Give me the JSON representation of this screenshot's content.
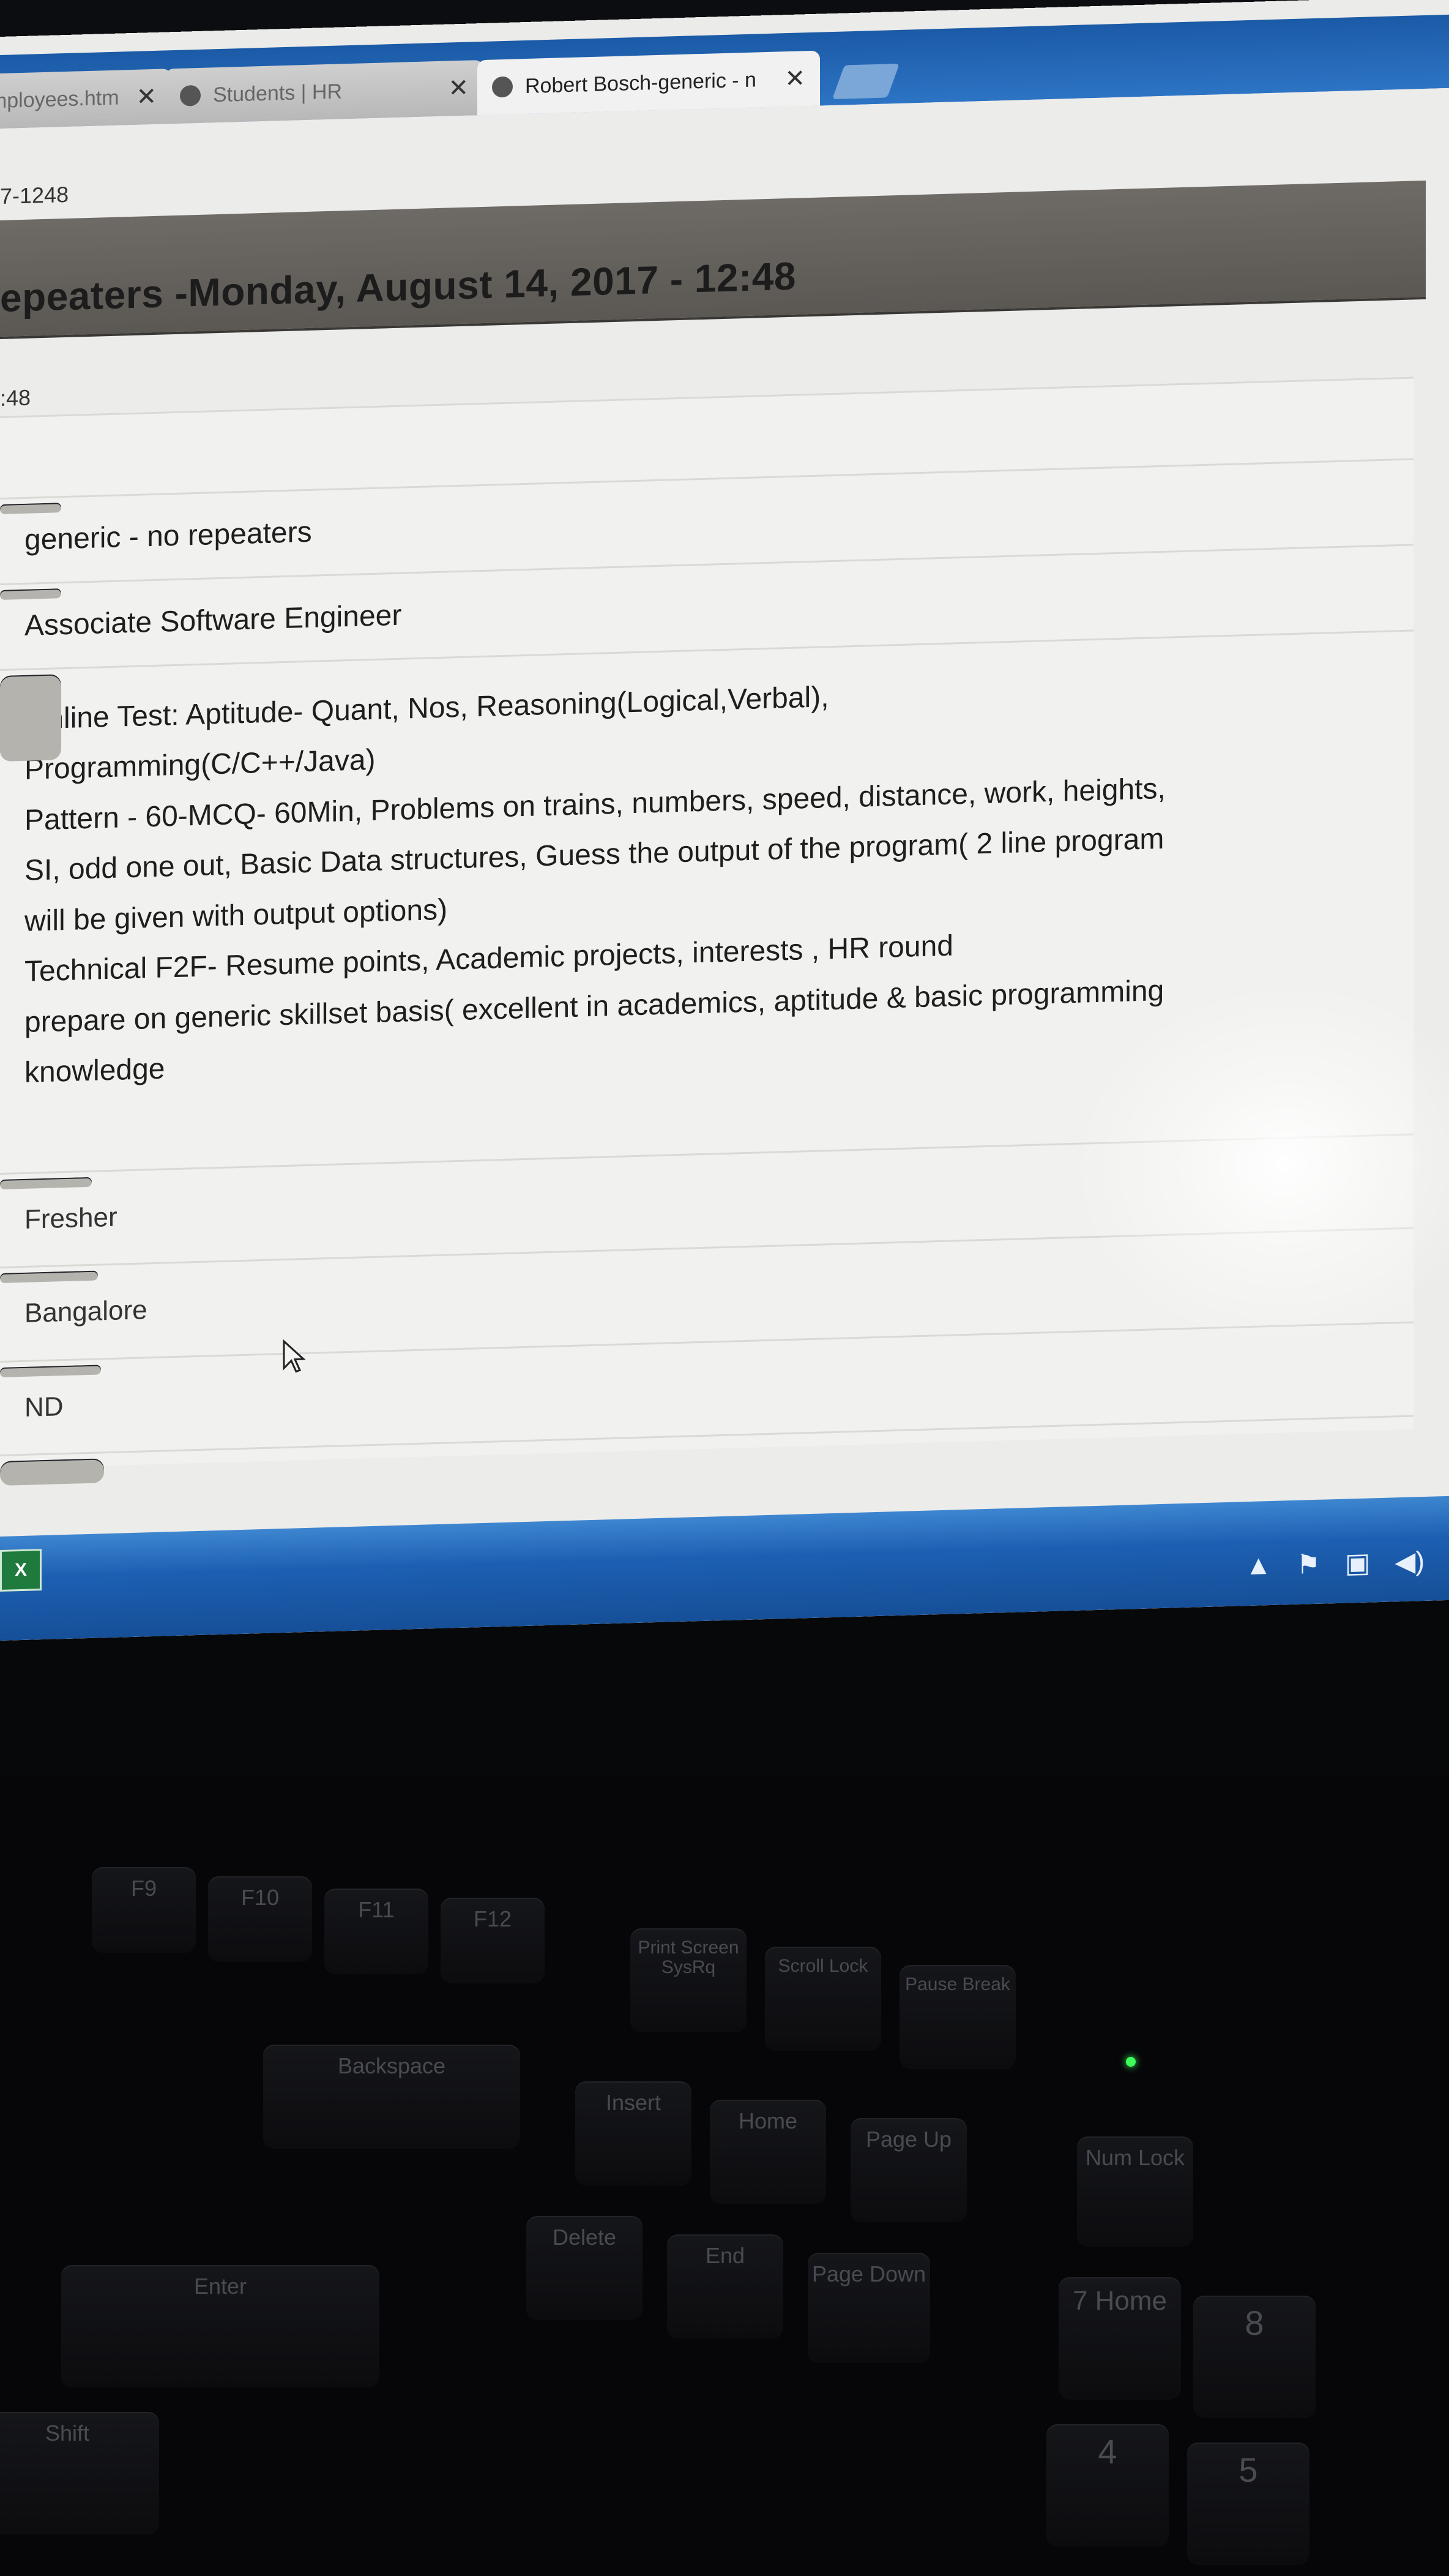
{
  "browser": {
    "tabs": [
      {
        "label": "employees.htm",
        "active": false
      },
      {
        "label": "Students | HR",
        "active": false
      },
      {
        "label": "Robert Bosch-generic - n",
        "active": true
      }
    ],
    "close_glyph": "✕"
  },
  "page": {
    "top_line": "7-1248",
    "title": "epeaters -Monday, August 14, 2017 - 12:48",
    "time": ":48",
    "rows": [
      {
        "value": ""
      },
      {
        "value": "generic - no repeaters"
      },
      {
        "value": "Associate Software Engineer"
      },
      {
        "lines": [
          "Online Test: Aptitude- Quant, Nos, Reasoning(Logical,Verbal),",
          "Programming(C/C++/Java)",
          "Pattern - 60-MCQ- 60Min, Problems on trains, numbers, speed, distance, work, heights,",
          "SI, odd one out, Basic Data structures, Guess the output of the program( 2 line program",
          "will be given with output options)",
          "Technical F2F- Resume points, Academic projects, interests , HR round",
          "prepare on generic skillset basis( excellent in academics, aptitude & basic programming",
          "knowledge"
        ]
      },
      {
        "value": "Fresher"
      },
      {
        "value": "Bangalore"
      },
      {
        "value": "ND"
      }
    ]
  },
  "taskbar": {
    "app_icon": "excel-icon",
    "tray_icons": [
      "show-hidden-icons-icon",
      "action-center-flag-icon",
      "network-icon",
      "volume-icon"
    ]
  },
  "keyboard": {
    "keys": [
      "F9",
      "F10",
      "F11",
      "F12",
      "Print Screen SysRq",
      "Scroll Lock",
      "Pause Break",
      "Backspace",
      "Insert",
      "Home",
      "Page Up",
      "Num Lock",
      "Delete",
      "End",
      "Page Down",
      "Enter",
      "7 Home",
      "8",
      "4",
      "5",
      "Shift"
    ]
  },
  "colors": {
    "taskbar": "#1c5fb2",
    "title_bar": "#6e6a66",
    "key_cell": "#b4b3ad"
  }
}
